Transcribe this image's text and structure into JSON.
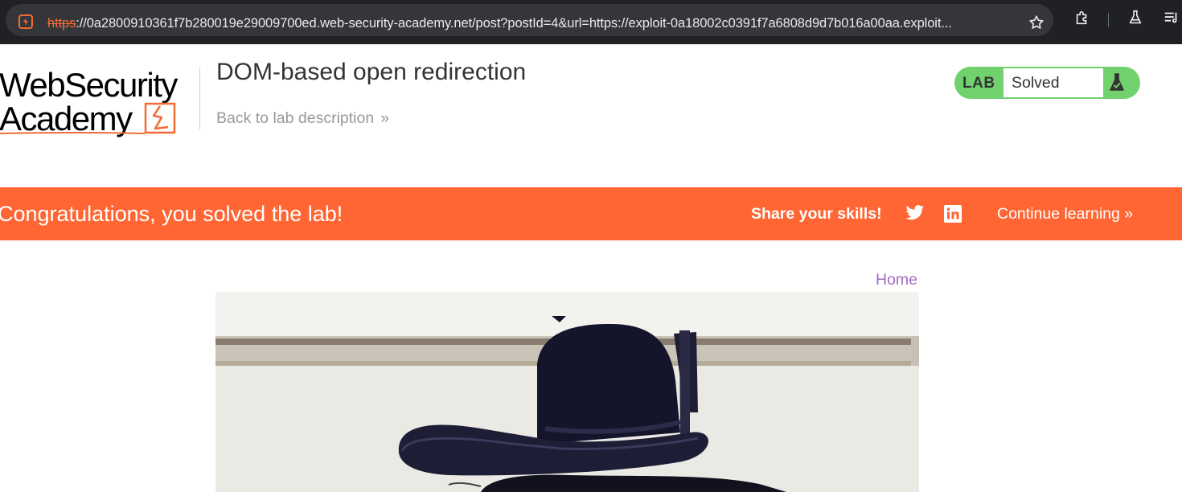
{
  "browser": {
    "url_scheme": "https",
    "url_rest": "://0a2800910361f7b280019e29009700ed.web-security-academy.net/post?postId=4&url=https://exploit-0a18002c0391f7a6808d9d7b016a00aa.exploit..."
  },
  "header": {
    "logo_line1": "WebSecurity",
    "logo_line2": "Academy",
    "title": "DOM-based open redirection",
    "back_link": "Back to lab description",
    "back_chevron": "»"
  },
  "lab_status": {
    "label": "LAB",
    "state": "Solved",
    "accent_color": "#70d16d"
  },
  "banner": {
    "message": "Congratulations, you solved the lab!",
    "share_label": "Share your skills!",
    "continue_label": "Continue learning",
    "continue_chevron": "»",
    "color": "#ff6633"
  },
  "nav": {
    "home": "Home"
  },
  "post": {
    "image_icon": "post-photo-bowler-hat"
  }
}
